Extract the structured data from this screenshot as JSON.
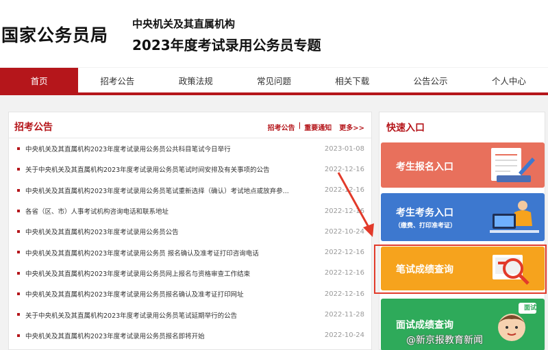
{
  "header": {
    "logo": "国家公务员局",
    "subtitle_line1": "中央机关及其直属机构",
    "subtitle_line2": "2023年度考试录用公务员专题"
  },
  "nav": {
    "items": [
      {
        "label": "首页",
        "active": true
      },
      {
        "label": "招考公告"
      },
      {
        "label": "政策法规"
      },
      {
        "label": "常见问题"
      },
      {
        "label": "相关下载"
      },
      {
        "label": "公告公示"
      },
      {
        "label": "个人中心"
      }
    ]
  },
  "announcements": {
    "title": "招考公告",
    "link1": "招考公告",
    "separator": "|",
    "link2": "重要通知",
    "more": "更多>>",
    "items": [
      {
        "title": "中央机关及其直属机构2023年度考试录用公务员公共科目笔试今日举行",
        "date": "2023-01-08"
      },
      {
        "title": "关于中央机关及其直属机构2023年度考试录用公务员笔试时间安排及有关事项的公告",
        "date": "2022-12-16"
      },
      {
        "title": "中央机关及其直属机构2023年度考试录用公务员笔试重新选择（确认）考试地点或放弃参...",
        "date": "2022-12-16"
      },
      {
        "title": "各省（区、市）人事考试机构咨询电话和联系地址",
        "date": "2022-12-16"
      },
      {
        "title": "中央机关及其直属机构2023年度考试录用公务员公告",
        "date": "2022-10-24"
      },
      {
        "title": "中央机关及其直属机构2023年度考试录用公务员 报名确认及准考证打印咨询电话",
        "date": "2022-12-16"
      },
      {
        "title": "中央机关及其直属机构2023年度考试录用公务员网上报名与资格审查工作结束",
        "date": "2022-12-16"
      },
      {
        "title": "中央机关及其直属机构2023年度考试录用公务员报名确认及准考证打印网址",
        "date": "2022-12-16"
      },
      {
        "title": "关于中央机关及其直属机构2023年度考试录用公务员笔试延期举行的公告",
        "date": "2022-11-28"
      },
      {
        "title": "中央机关及其直属机构2023年度考试录用公务员报名即将开始",
        "date": "2022-10-24"
      }
    ]
  },
  "quick_entry": {
    "title": "快速入口",
    "cards": [
      {
        "label": "考生报名入口",
        "color": "#e8705c"
      },
      {
        "label": "考生考务入口",
        "sublabel": "（缴费、打印准考证）",
        "color": "#3d78cf"
      },
      {
        "label": "笔试成绩查询",
        "color": "#f6a31d"
      },
      {
        "label": "面试成绩查询",
        "color": "#2eaa5a",
        "badge": "面试"
      }
    ]
  },
  "watermark": {
    "text": "@新京报教育新闻"
  },
  "highlight_color": "#e23a2a"
}
